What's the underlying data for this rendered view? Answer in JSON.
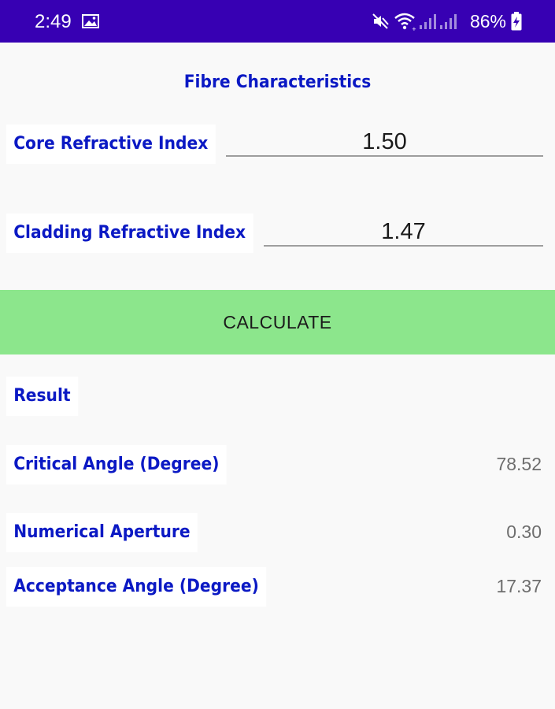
{
  "status_bar": {
    "time": "2:49",
    "battery": "86%",
    "icons": [
      "image-icon",
      "mute-icon",
      "wifi-icon",
      "signal-icon",
      "signal-icon",
      "battery-charging-icon"
    ]
  },
  "app": {
    "title": "Fibre Characteristics",
    "core_label": "Core Refractive Index",
    "core_value": "1.50",
    "cladding_label": "Cladding Refractive Index",
    "cladding_value": "1.47",
    "calculate_label": "CALCULATE",
    "result_label": "Result",
    "results": [
      {
        "label": "Critical Angle (Degree)",
        "value": "78.52"
      },
      {
        "label": "Numerical Aperture",
        "value": "0.30"
      },
      {
        "label": "Acceptance Angle (Degree)",
        "value": "17.37"
      }
    ]
  },
  "colors": {
    "status_bar": "#3700b3",
    "label_text": "#0b19c4",
    "button": "#8ce68c",
    "background": "#f9f9f9"
  }
}
